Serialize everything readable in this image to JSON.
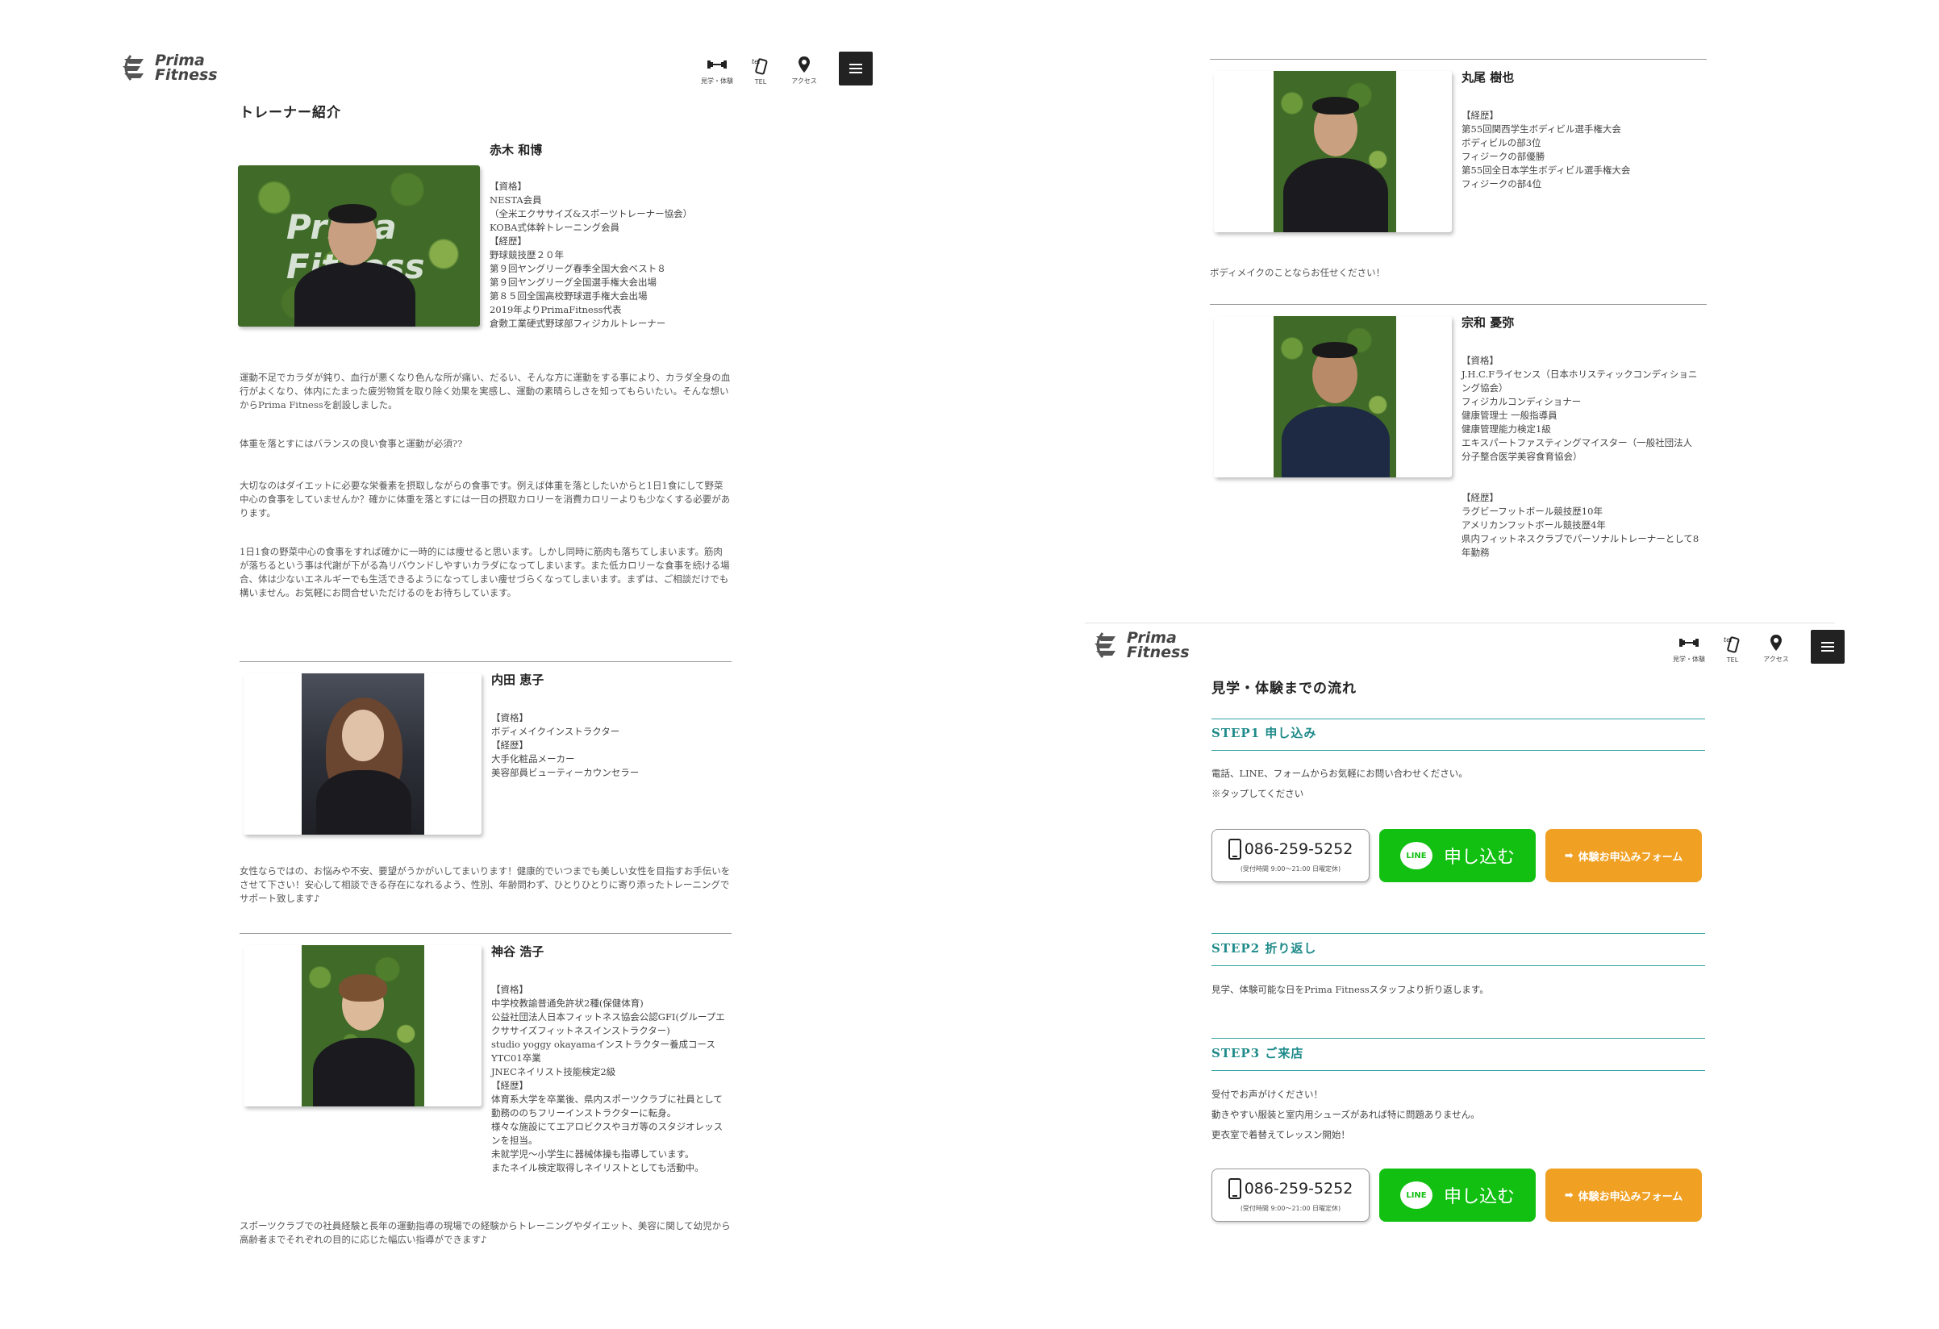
{
  "brand": {
    "line1": "Prima",
    "line2": "Fitness"
  },
  "nav": {
    "visit_label": "見学・体験",
    "tel_label": "TEL",
    "access_label": "アクセス"
  },
  "trainers_page": {
    "title": "トレーナー紹介",
    "photo_logo_text": "Prima Fitness",
    "trainers": [
      {
        "name": "赤木 和博",
        "info": "【資格】\nNESTA会員\n（全米エクササイズ&スポーツトレーナー協会）\nKOBA式体幹トレーニング会員\n【経歴】\n野球競技歴２０年\n第９回ヤングリーグ春季全国大会ベスト８\n第９回ヤングリーグ全国選手権大会出場\n第８５回全国高校野球選手権大会出場\n2019年よりPrimaFitness代表\n倉敷工業硬式野球部フィジカルトレーナー",
        "paragraphs": [
          "運動不足でカラダが鈍り、血行が悪くなり色んな所が痛い、だるい、そんな方に運動をする事により、カラダ全身の血行がよくなり、体内にたまった疲労物質を取り除く効果を実感し、運動の素晴らしさを知ってもらいたい。そんな想いからPrima Fitnessを創設しました。",
          "体重を落とすにはバランスの良い食事と運動が必須??",
          "大切なのはダイエットに必要な栄養素を摂取しながらの食事です。例えば体重を落としたいからと1日1食にして野菜中心の食事をしていませんか？確かに体重を落とすには一日の摂取カロリーを消費カロリーよりも少なくする必要があります。",
          "1日1食の野菜中心の食事をすれば確かに一時的には痩せると思います。しかし同時に筋肉も落ちてしまいます。筋肉が落ちるという事は代謝が下がる為リバウンドしやすいカラダになってしまいます。また低カロリーな食事を続ける場合、体は少ないエネルギーでも生活できるようになってしまい痩せづらくなってしまいます。まずは、ご相談だけでも構いません。お気軽にお問合せいただけるのをお待ちしています。"
        ]
      },
      {
        "name": "内田 恵子",
        "info": "【資格】\nボディメイクインストラクター\n【経歴】\n大手化粧品メーカー\n美容部員ビューティーカウンセラー",
        "paragraph": "女性ならではの、お悩みや不安、要望がうかがいしてまいります！健康的でいつまでも美しい女性を目指すお手伝いをさせて下さい！安心して相談できる存在になれるよう、性別、年齢問わず、ひとりひとりに寄り添ったトレーニングでサポート致します♪"
      },
      {
        "name": "神谷 浩子",
        "info": "【資格】\n中学校教諭普通免許状2種(保健体育)\n公益社団法人日本フィットネス協会公認GFI(グループエクササイズフィットネスインストラクター)\nstudio yoggy okayamaインストラクター養成コース\nYTC01卒業\nJNECネイリスト技能検定2級\n【経歴】\n体育系大学を卒業後、県内スポーツクラブに社員として勤務ののちフリーインストラクターに転身。\n様々な施設にてエアロビクスやヨガ等のスタジオレッスンを担当。\n未就学児〜小学生に器械体操も指導しています。\nまたネイル検定取得しネイリストとしても活動中。",
        "paragraph": "スポーツクラブでの社員経験と長年の運動指導の現場での経験からトレーニングやダイエット、美容に関して幼児から高齢者までそれぞれの目的に応じた幅広い指導ができます♪"
      },
      {
        "name": "丸尾 樹也",
        "info": "【経歴】\n第55回関西学生ボディビル選手権大会\nボディビルの部3位\nフィジークの部優勝\n第55回全日本学生ボディビル選手権大会\nフィジークの部4位",
        "paragraph": "ボディメイクのことならお任せください！"
      },
      {
        "name": "宗和 憂弥",
        "info": "【資格】\nJ.H.C.Fライセンス（日本ホリスティックコンディショニング協会）\nフィジカルコンディショナー\n健康管理士 一般指導員\n健康管理能力検定1級\nエキスパートファスティングマイスター（一般社団法人 分子整合医学美容食育協会）",
        "history": "【経歴】\nラグビーフットボール競技歴10年\nアメリカンフットボール競技歴4年\n県内フィットネスクラブでパーソナルトレーナーとして8年勤務"
      }
    ]
  },
  "flow_page": {
    "title": "見学・体験までの流れ",
    "steps": [
      {
        "title": "STEP1 申し込み",
        "lines": [
          "電話、LINE、フォームからお気軽にお問い合わせください。",
          "※タップしてください"
        ]
      },
      {
        "title": "STEP2 折り返し",
        "lines": [
          "見学、体験可能な日をPrima Fitnessスタッフより折り返します。"
        ]
      },
      {
        "title": "STEP3 ご来店",
        "lines": [
          "受付でお声がけください！",
          "動きやすい服装と室内用シューズがあれば特に問題ありません。",
          "更衣室で着替えてレッスン開始！"
        ]
      }
    ],
    "tel_number": "086-259-5252",
    "tel_hours": "(受付時間 9:00〜21:00 日曜定休)",
    "line_logo_text": "LINE",
    "line_label": "申し込む",
    "form_label": "体験お申込みフォーム"
  },
  "colors": {
    "accent_teal": "#1f8a8a",
    "line_green": "#12c012",
    "form_orange": "#f0a022"
  }
}
